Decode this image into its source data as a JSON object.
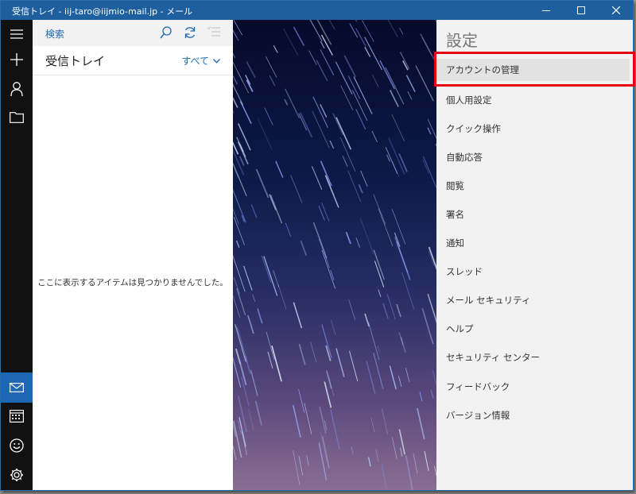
{
  "window": {
    "title": "受信トレイ - iij-taro@iijmio-mail.jp - メール"
  },
  "nav": {
    "items": [
      {
        "icon": "hamburger-menu-icon"
      },
      {
        "icon": "plus-icon"
      },
      {
        "icon": "person-icon"
      },
      {
        "icon": "folder-icon"
      },
      {
        "icon": "mail-icon"
      },
      {
        "icon": "calendar-icon"
      },
      {
        "icon": "smiley-icon"
      },
      {
        "icon": "gear-icon"
      }
    ],
    "active_color": "#1d67b5"
  },
  "list": {
    "search_label": "検索",
    "inbox_title": "受信トレイ",
    "filter_label": "すべて",
    "empty_message": "ここに表示するアイテムは見つかりませんでした。"
  },
  "settings": {
    "title": "設定",
    "items": [
      "アカウントの管理",
      "個人用設定",
      "クイック操作",
      "自動応答",
      "閲覧",
      "署名",
      "通知",
      "スレッド",
      "メール セキュリティ",
      "ヘルプ",
      "セキュリティ センター",
      "フィードバック",
      "バージョン情報"
    ],
    "selected": "アカウントの管理",
    "highlight_color": "#e60012"
  }
}
